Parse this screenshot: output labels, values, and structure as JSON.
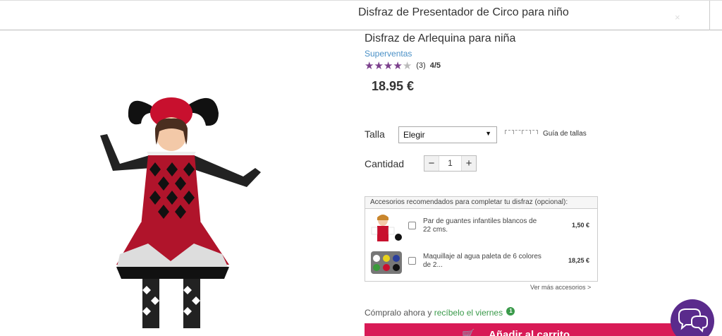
{
  "header": {
    "title": "Disfraz de Presentador de Circo para niño",
    "close_glyph": "×"
  },
  "product": {
    "name": "Disfraz de Arlequina para niña",
    "badge": "Superventas",
    "rating": {
      "stars": 4,
      "max": 5,
      "count": "(3)",
      "score": "4/5"
    },
    "price": "18.95 €",
    "image_icon": "harlequin-costume-photo"
  },
  "options": {
    "size_label": "Talla",
    "size_value": "Elegir",
    "size_guide": "Guía de tallas",
    "quantity_label": "Cantidad",
    "quantity_value": "1",
    "minus": "−",
    "plus": "+"
  },
  "accessories": {
    "title": "Accesorios recomendados para completar tu disfraz (opcional):",
    "items": [
      {
        "name": "Par de guantes infantiles blancos de 22 cms.",
        "price": "1,50 €",
        "icon": "gloves-thumbnail"
      },
      {
        "name": "Maquillaje al agua paleta de 6 colores de 2...",
        "price": "18,25 €",
        "icon": "makeup-palette-thumbnail"
      }
    ],
    "more": "Ver más accesorios >"
  },
  "delivery": {
    "prefix": "Cómpralo ahora y ",
    "highlight": "recíbelo el viernes",
    "info": "1"
  },
  "cart": {
    "label": "Añadir al carrito",
    "icon": "cart-icon"
  },
  "colors": {
    "accent": "#d81a56",
    "stars": "#7b3f8c",
    "link": "#4a90c6",
    "delivery": "#3a9a4a",
    "chat": "#5a2b8c"
  }
}
